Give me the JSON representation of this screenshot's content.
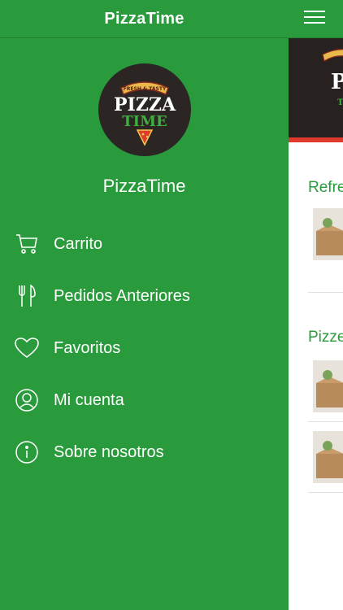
{
  "app": {
    "title": "PizzaTime",
    "name": "PizzaTime",
    "logo_text_top": "FRESH & TASTY",
    "logo_text_main": "PIZZA",
    "logo_text_sub": "TIME"
  },
  "menu": {
    "items": [
      {
        "label": "Carrito",
        "icon": "cart-icon"
      },
      {
        "label": "Pedidos Anteriores",
        "icon": "cutlery-icon"
      },
      {
        "label": "Favoritos",
        "icon": "heart-icon"
      },
      {
        "label": "Mi cuenta",
        "icon": "user-icon"
      },
      {
        "label": "Sobre nosotros",
        "icon": "info-icon"
      }
    ]
  },
  "main": {
    "sections": [
      {
        "title": "Refre"
      },
      {
        "title": "Pizze"
      }
    ]
  },
  "colors": {
    "brand_green": "#2a9b3c",
    "accent_red": "#e0392d",
    "logo_dark": "#2b2624"
  }
}
